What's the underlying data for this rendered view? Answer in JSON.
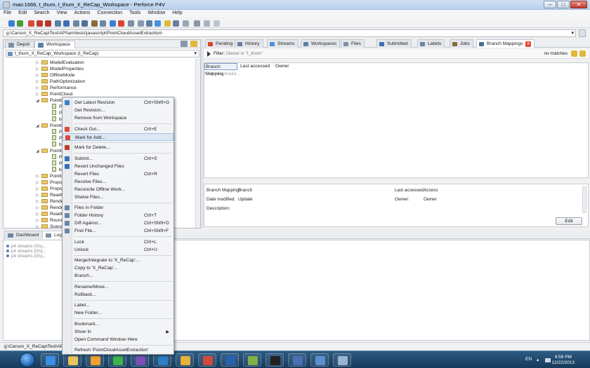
{
  "window": {
    "title": "mao:1666, t_thum, t_thum_X_ReCap_Workspace - Perforce P4V"
  },
  "menubar": [
    "File",
    "Edit",
    "Search",
    "View",
    "Actions",
    "Connection",
    "Tools",
    "Window",
    "Help"
  ],
  "path": "g:\\Carson_X_ReCap\\Test\\API\\am\\tests\\javascript\\PointCloudAssetExtraction\\",
  "left": {
    "tabs": [
      {
        "label": "Depot",
        "icon": "depot-icon"
      },
      {
        "label": "Workspace",
        "icon": "workspace-icon"
      }
    ],
    "workspace": "t_thum_X_ReCap_Workspace (t_ReCap)",
    "tree": [
      {
        "label": "ModelEvaluation",
        "type": "folder",
        "indent": 0,
        "exp": "▷"
      },
      {
        "label": "ModelProperties",
        "type": "folder",
        "indent": 0,
        "exp": "▷"
      },
      {
        "label": "OfflineMode",
        "type": "folder",
        "indent": 0,
        "exp": "▷"
      },
      {
        "label": "PathOptimization",
        "type": "folder",
        "indent": 0,
        "exp": "▷"
      },
      {
        "label": "Performance",
        "type": "folder",
        "indent": 0,
        "exp": "▷"
      },
      {
        "label": "PointCloud",
        "type": "folder",
        "indent": 0,
        "exp": "▷"
      },
      {
        "label": "PointC",
        "type": "folder",
        "indent": 0,
        "exp": "◢"
      },
      {
        "label": "Po",
        "type": "file",
        "indent": 1,
        "exp": ""
      },
      {
        "label": "Po",
        "type": "file",
        "indent": 1,
        "exp": ""
      },
      {
        "label": "bo",
        "type": "file",
        "indent": 1,
        "exp": ""
      },
      {
        "label": "PointC",
        "type": "folder",
        "indent": 0,
        "exp": "◢"
      },
      {
        "label": "Po",
        "type": "file",
        "indent": 1,
        "exp": ""
      },
      {
        "label": "Po",
        "type": "file",
        "indent": 1,
        "exp": ""
      },
      {
        "label": "bo",
        "type": "file",
        "indent": 1,
        "exp": ""
      },
      {
        "label": "PointC",
        "type": "folder",
        "indent": 0,
        "exp": "◢"
      },
      {
        "label": "Po",
        "type": "file",
        "indent": 1,
        "exp": ""
      },
      {
        "label": "Po",
        "type": "file",
        "indent": 1,
        "exp": ""
      },
      {
        "label": "bo",
        "type": "file",
        "indent": 1,
        "exp": ""
      },
      {
        "label": "PointC",
        "type": "folder",
        "indent": 0,
        "exp": "▷"
      },
      {
        "label": "Propos",
        "type": "folder",
        "indent": 0,
        "exp": "▷"
      },
      {
        "label": "Propos",
        "type": "folder",
        "indent": 0,
        "exp": "▷"
      },
      {
        "label": "ReadO",
        "type": "folder",
        "indent": 0,
        "exp": "▷"
      },
      {
        "label": "Render",
        "type": "folder",
        "indent": 0,
        "exp": "▷"
      },
      {
        "label": "Render",
        "type": "folder",
        "indent": 0,
        "exp": "▷"
      },
      {
        "label": "RoadG",
        "type": "folder",
        "indent": 0,
        "exp": "▷"
      },
      {
        "label": "Round",
        "type": "folder",
        "indent": 0,
        "exp": "▷"
      },
      {
        "label": "Scena",
        "type": "folder",
        "indent": 0,
        "exp": "▷"
      }
    ]
  },
  "right": {
    "tabs": [
      {
        "label": "Pending",
        "icon": "pending-icon",
        "color": "#d9442e"
      },
      {
        "label": "History",
        "icon": "history-icon",
        "color": "#6a7f9e"
      },
      {
        "label": "Streams",
        "icon": "streams-icon",
        "color": "#4a90d9"
      },
      {
        "label": "Workspaces",
        "icon": "workspaces-icon",
        "color": "#5a7fa8"
      },
      {
        "label": "Files",
        "icon": "files-icon",
        "color": "#7d8fa5"
      },
      {
        "label": "Submitted",
        "icon": "submitted-icon",
        "color": "#3d6fb0"
      },
      {
        "label": "Labels",
        "icon": "labels-icon",
        "color": "#6a86a6"
      },
      {
        "label": "Jobs",
        "icon": "jobs-icon",
        "color": "#8a6a3a"
      },
      {
        "label": "Branch Mappings",
        "icon": "branch-icon",
        "color": "#4a6f98"
      }
    ],
    "filter": {
      "label": "Filter:",
      "value": "Owner is \"t_thum\"",
      "matches": "no matches"
    },
    "columns": [
      "Branch Mapping",
      "Last accessed",
      "Owner"
    ],
    "empty_text": "No Items Availa...",
    "details": {
      "branch_label": "Branch Mapping:",
      "branch_value": "Branch",
      "modified_label": "Date modified:",
      "modified_value": "Update",
      "desc_label": "Description:",
      "accessed_label": "Last accessed:",
      "accessed_value": "Access",
      "owner_label": "Owner:",
      "owner_value": "Owner",
      "edit_label": "Edit"
    }
  },
  "bottom": {
    "tabs": [
      {
        "label": "Dashboard",
        "icon": "dashboard-icon"
      },
      {
        "label": "Log",
        "icon": "log-icon"
      }
    ],
    "log": [
      "p4 streams (0/s)...",
      "p4 streams (0/s)...",
      "p4 streams (0/s)..."
    ]
  },
  "status": {
    "path": "g:\\Carson_X_ReCap\\Test\\API\\a"
  },
  "context_menu": [
    {
      "label": "Get Latest Revision",
      "shortcut": "Ctrl+Shift+G",
      "icon": "get-latest-icon",
      "color": "#3a7fd0"
    },
    {
      "label": "Get Revision...",
      "shortcut": "",
      "icon": "",
      "color": ""
    },
    {
      "label": "Remove from Workspace",
      "shortcut": "",
      "icon": "",
      "color": ""
    },
    {
      "sep": true
    },
    {
      "label": "Check Out...",
      "shortcut": "Ctrl+E",
      "icon": "checkout-icon",
      "color": "#d94a3a"
    },
    {
      "label": "Mark for Add...",
      "shortcut": "",
      "icon": "add-icon",
      "color": "#d94a3a",
      "hl": true
    },
    {
      "sep": true
    },
    {
      "label": "Mark for Delete...",
      "shortcut": "",
      "icon": "delete-icon",
      "color": "#c23a2a"
    },
    {
      "sep": true
    },
    {
      "label": "Submit...",
      "shortcut": "Ctrl+S",
      "icon": "submit-icon",
      "color": "#3a6fb5"
    },
    {
      "label": "Revert Unchanged Files",
      "shortcut": "",
      "icon": "revert-unchanged-icon",
      "color": "#3a6fb5"
    },
    {
      "label": "Revert Files",
      "shortcut": "Ctrl+R",
      "icon": "",
      "color": ""
    },
    {
      "label": "Resolve Files...",
      "shortcut": "",
      "icon": "",
      "color": ""
    },
    {
      "label": "Reconcile Offline Work...",
      "shortcut": "",
      "icon": "",
      "color": ""
    },
    {
      "label": "Shelve Files...",
      "shortcut": "",
      "icon": "",
      "color": ""
    },
    {
      "sep": true
    },
    {
      "label": "Files in Folder",
      "shortcut": "",
      "icon": "files-folder-icon",
      "color": "#6a86a6"
    },
    {
      "label": "Folder History",
      "shortcut": "Ctrl+T",
      "icon": "folder-history-icon",
      "color": "#6a86a6"
    },
    {
      "label": "Diff Against...",
      "shortcut": "Ctrl+Shift+D",
      "icon": "diff-icon",
      "color": "#6a86a6"
    },
    {
      "label": "Find File...",
      "shortcut": "Ctrl+Shift+F",
      "icon": "find-icon",
      "color": "#6a86a6"
    },
    {
      "sep": true
    },
    {
      "label": "Lock",
      "shortcut": "Ctrl+L",
      "icon": "",
      "color": ""
    },
    {
      "label": "Unlock",
      "shortcut": "Ctrl+U",
      "icon": "",
      "color": ""
    },
    {
      "sep": true
    },
    {
      "label": "Merge/Integrate to 'X_ReCap'...",
      "shortcut": "",
      "icon": "",
      "color": ""
    },
    {
      "label": "Copy to 'X_ReCap'...",
      "shortcut": "",
      "icon": "",
      "color": ""
    },
    {
      "label": "Branch...",
      "shortcut": "",
      "icon": "",
      "color": ""
    },
    {
      "sep": true
    },
    {
      "label": "Rename/Move...",
      "shortcut": "",
      "icon": "",
      "color": ""
    },
    {
      "label": "Rollback...",
      "shortcut": "",
      "icon": "",
      "color": ""
    },
    {
      "sep": true
    },
    {
      "label": "Label...",
      "shortcut": "",
      "icon": "",
      "color": ""
    },
    {
      "label": "New Folder...",
      "shortcut": "",
      "icon": "",
      "color": ""
    },
    {
      "sep": true
    },
    {
      "label": "Bookmark...",
      "shortcut": "",
      "icon": "",
      "color": ""
    },
    {
      "label": "Show In",
      "shortcut": "",
      "icon": "",
      "color": "",
      "submenu": true
    },
    {
      "label": "Open Command Window Here",
      "shortcut": "",
      "icon": "",
      "color": ""
    },
    {
      "sep": true
    },
    {
      "label": "Refresh 'PointCloudAssetExtraction'",
      "shortcut": "",
      "icon": "",
      "color": ""
    }
  ],
  "taskbar": {
    "apps": [
      {
        "name": "ie-icon",
        "color": "#3a8ee6"
      },
      {
        "name": "explorer-icon",
        "color": "#e8c45a"
      },
      {
        "name": "media-player-icon",
        "color": "#f0a030"
      },
      {
        "name": "chrome-icon",
        "color": "#3cb44b"
      },
      {
        "name": "visual-studio-icon",
        "color": "#7b4fb6"
      },
      {
        "name": "p4v-icon",
        "color": "#2e7fc4"
      },
      {
        "name": "outlook-icon",
        "color": "#e6b23a"
      },
      {
        "name": "messenger-icon",
        "color": "#d24a3a"
      },
      {
        "name": "word-icon",
        "color": "#2b5fb0"
      },
      {
        "name": "notepad-icon",
        "color": "#7fb04a"
      },
      {
        "name": "cmd-icon",
        "color": "#222222"
      },
      {
        "name": "network-icon",
        "color": "#4a6fb5"
      },
      {
        "name": "remote-icon",
        "color": "#5a8fd0"
      },
      {
        "name": "snipping-icon",
        "color": "#9ab4d0"
      }
    ],
    "lang": "EN",
    "time": "4:58 PM",
    "date": "12/22/2013"
  }
}
